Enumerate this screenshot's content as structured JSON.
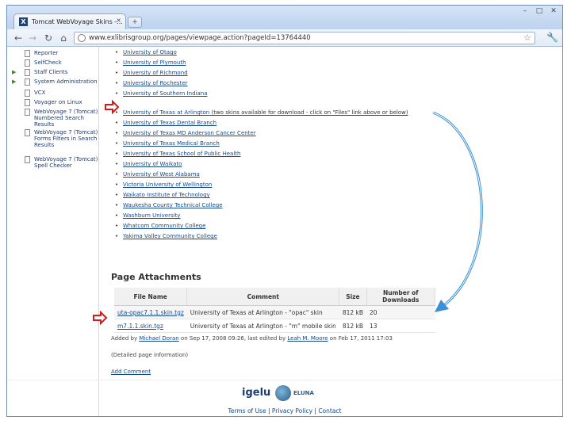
{
  "browser": {
    "tab_title": "Tomcat WebVoyage Skins -...",
    "tab_close": "×",
    "new_tab": "+",
    "window_controls": [
      "–",
      "□",
      "✕"
    ],
    "url": "www.exlibrisgroup.org/pages/viewpage.action?pageId=13764440"
  },
  "sidebar": {
    "items": [
      {
        "label": "Reporter",
        "expandable": false
      },
      {
        "label": "SelfCheck",
        "expandable": false
      },
      {
        "label": "Staff Clients",
        "expandable": true
      },
      {
        "label": "System Administration",
        "expandable": true
      },
      {
        "label": "VCX",
        "expandable": false
      },
      {
        "label": "Voyager on Linux",
        "expandable": false
      },
      {
        "label": "WebVoyage 7 (Tomcat) Numbered Search Results",
        "expandable": false
      },
      {
        "label": "WebVoyage 7 (Tomcat) Forms Filters in Search Results",
        "expandable": false
      },
      {
        "label": "WebVoyage 7 (Tomcat) Spell Checker",
        "expandable": false
      }
    ]
  },
  "main": {
    "universities": [
      "University of Otago",
      "University of Plymouth",
      "University of Richmond",
      "University of Rochester",
      "University of Southern Indiana",
      "University of Texas at Arlington",
      "University of Texas Dental Branch",
      "University of Texas MD Anderson Cancer Center",
      "University of Texas Medical Branch",
      "University of Texas School of Public Health",
      "University of Waikato",
      "University of West Alabama",
      "Victoria University of Wellington",
      "Waikato Institute of Technology",
      "Waukesha County Technical College",
      "Washburn University",
      "Whatcom Community College",
      "Yakima Valley Community College"
    ],
    "arlington_note": "(two skins available for download - click on \"Files\" link above or below)",
    "attachments": {
      "title": "Page Attachments",
      "headers": [
        "File Name",
        "Comment",
        "Size",
        "Number of Downloads"
      ],
      "rows": [
        {
          "file": "uta-opac7.1.1.skin.tgz",
          "comment": "University of Texas at Arlington - \"opac\" skin",
          "size": "812 kB",
          "downloads": "20"
        },
        {
          "file": "m7.1.1.skin.tgz",
          "comment": "University of Texas at Arlington - \"m\" mobile skin",
          "size": "812 kB",
          "downloads": "13"
        }
      ]
    },
    "added_by_prefix": "Added by",
    "added_by_user": "Michael Doran",
    "added_by_middle": "on Sep 17, 2008 09:26, last edited by",
    "edited_by_user": "Leah M. Moore",
    "added_by_suffix": "on Feb 17, 2011 17:03",
    "detailed_info": "(Detailed page information)",
    "add_comment": "Add Comment"
  },
  "footer": {
    "logo_igelu": "igelu",
    "logo_eluna": "ELUNA",
    "terms": "Terms of Use",
    "separator": " | ",
    "privacy": "Privacy Policy",
    "contact": "Contact"
  },
  "colors": {
    "link": "#15488c",
    "annotation_arrow": "#d11b1b",
    "curve_arrow": "#3b8fd8"
  }
}
